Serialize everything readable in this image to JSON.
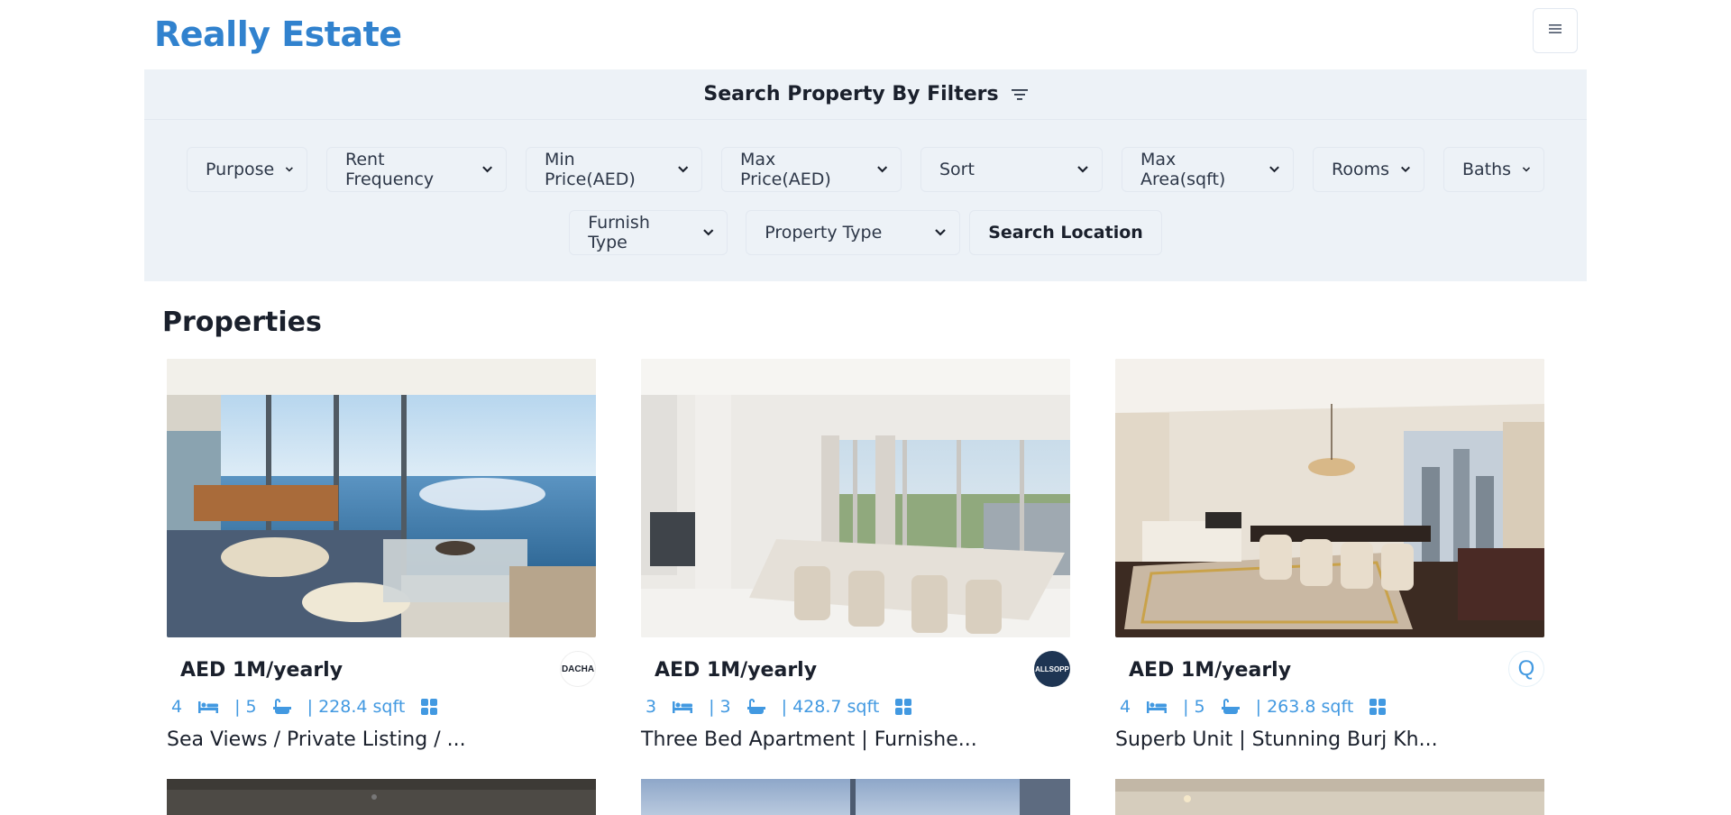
{
  "app": {
    "brand": "Really Estate",
    "menu_icon": "hamburger-icon"
  },
  "filters": {
    "title": "Search Property By Filters",
    "title_icon": "filter-lines-icon",
    "row1": [
      "Purpose",
      "Rent Frequency",
      "Min Price(AED)",
      "Max Price(AED)",
      "Sort",
      "Max Area(sqft)",
      "Rooms",
      "Baths"
    ],
    "row2": [
      "Furnish Type",
      "Property Type"
    ],
    "search_location": "Search Location"
  },
  "section": {
    "title": "Properties"
  },
  "properties": [
    {
      "price": "AED 1M/yearly",
      "rooms": "4",
      "baths": "| 5",
      "area": "| 228.4 sqft",
      "title": "Sea Views / Private Listing / ...",
      "agency_logo": "DACHA",
      "image_desc": "living-room-sea-view"
    },
    {
      "price": "AED 1M/yearly",
      "rooms": "3",
      "baths": "| 3",
      "area": "| 428.7 sqft",
      "title": "Three Bed Apartment | Furnishe...",
      "agency_logo": "ALLSOPP",
      "image_desc": "dining-room-city-view"
    },
    {
      "price": "AED 1M/yearly",
      "rooms": "4",
      "baths": "| 5",
      "area": "| 263.8 sqft",
      "title": "Superb Unit | Stunning Burj Kh...",
      "agency_logo": "Q",
      "image_desc": "dining-living-room"
    }
  ],
  "colors": {
    "brand": "#3182ce",
    "accent": "#4299e1",
    "filter_bg": "#edf2f7"
  }
}
